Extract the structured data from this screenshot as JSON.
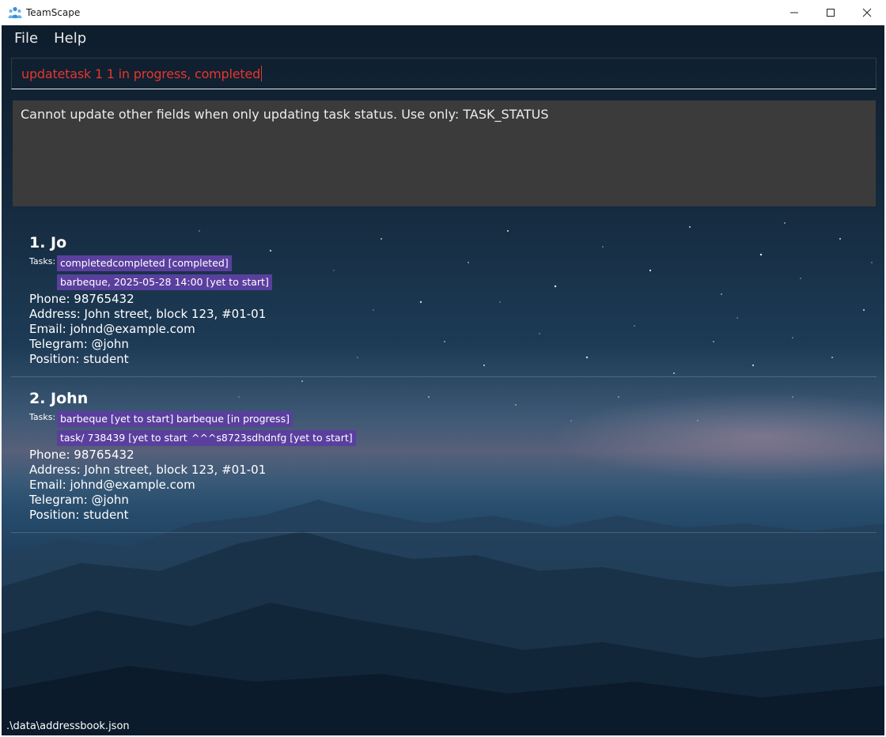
{
  "window": {
    "title": "TeamScape",
    "icon": "team-people-icon"
  },
  "menu": {
    "items": [
      {
        "label": "File"
      },
      {
        "label": "Help"
      }
    ]
  },
  "command": {
    "value": "updatetask 1 1 in progress, completed"
  },
  "result": {
    "message": "Cannot update other fields when only updating task status. Use only: TASK_STATUS"
  },
  "persons": [
    {
      "name": "1. Jo",
      "tasks_label": "Tasks:",
      "tasks": [
        "completedcompleted [completed]",
        "barbeque, 2025-05-28 14:00 [yet to start]"
      ],
      "phone": "Phone: 98765432",
      "address": "Address: John street, block 123, #01-01",
      "email": "Email: johnd@example.com",
      "telegram": "Telegram: @john",
      "position": "Position: student"
    },
    {
      "name": "2. John",
      "tasks_label": "Tasks:",
      "tasks": [
        "barbeque [yet to start]",
        "barbeque [in progress]",
        "task/ 738439 [yet to start]",
        "^^^s8723sdhdnfg [yet to start]"
      ],
      "phone": "Phone: 98765432",
      "address": "Address: John street, block 123, #01-01",
      "email": "Email: johnd@example.com",
      "telegram": "Telegram: @john",
      "position": "Position: student"
    }
  ],
  "status": {
    "file_path": ".\\data\\addressbook.json"
  },
  "colors": {
    "tag_bg": "#5a3f9e",
    "error_text": "#e8352c",
    "result_bg": "#3b3b3b"
  }
}
